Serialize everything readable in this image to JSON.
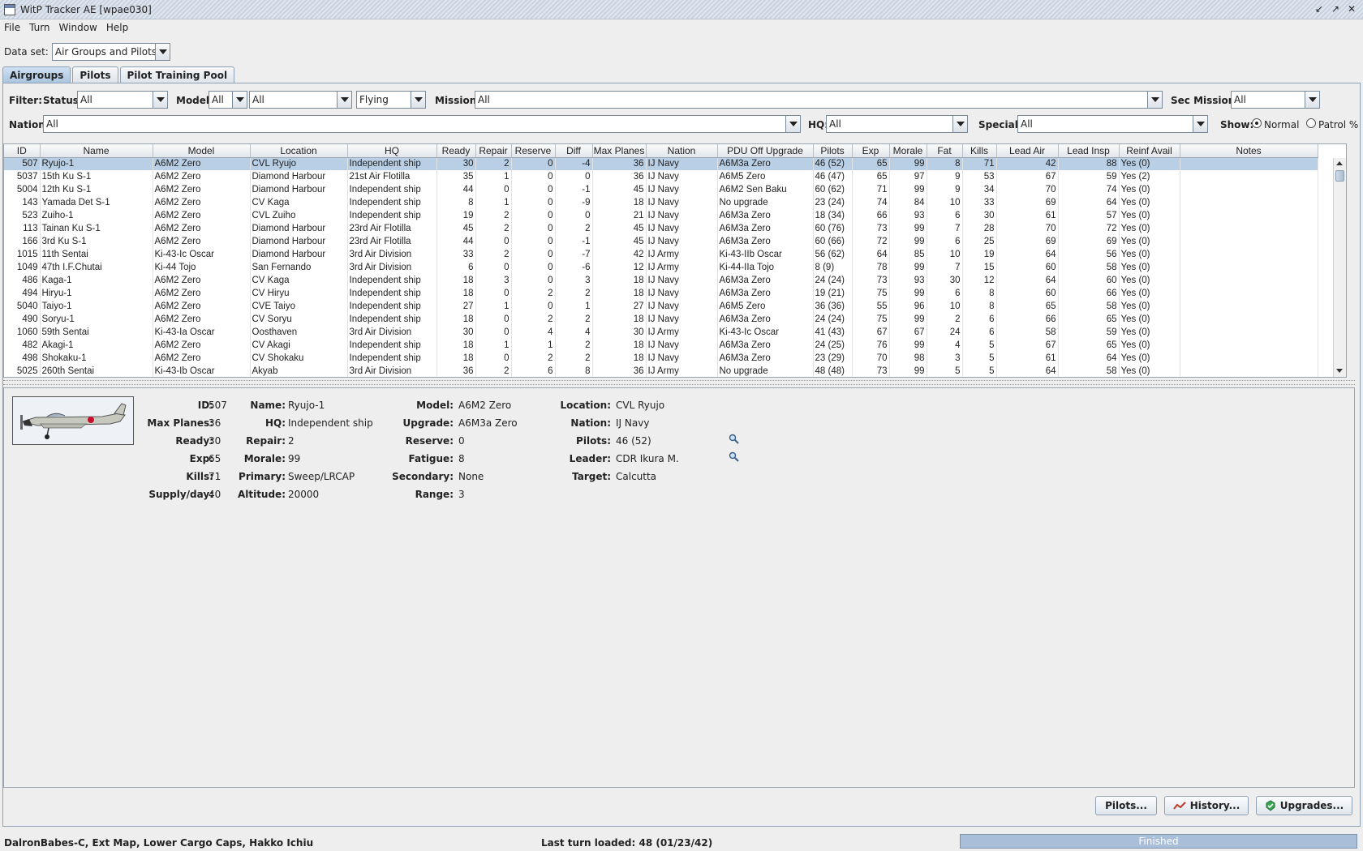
{
  "window": {
    "title": "WitP Tracker AE [wpae030]"
  },
  "menu": [
    "File",
    "Turn",
    "Window",
    "Help"
  ],
  "dataset": {
    "label": "Data set:",
    "value": "Air Groups and Pilots"
  },
  "tabs": [
    "Airgroups",
    "Pilots",
    "Pilot Training Pool"
  ],
  "filters": {
    "filter_label": "Filter:",
    "status_label": "Status:",
    "status_value": "All",
    "model_label": "Model:",
    "model_value1": "All",
    "model_value2": "All",
    "flying_value": "Flying",
    "mission_label": "Mission:",
    "mission_value": "All",
    "sec_mission_label": "Sec Mission:",
    "sec_mission_value": "All",
    "nation_label": "Nation:",
    "nation_value": "All",
    "hq_label": "HQ:",
    "hq_value": "All",
    "special_label": "Special:",
    "special_value": "All",
    "show_label": "Show:",
    "show_normal": "Normal",
    "show_patrol": "Patrol %"
  },
  "table": {
    "columns": [
      "ID",
      "Name",
      "Model",
      "Location",
      "HQ",
      "Ready",
      "Repair",
      "Reserve",
      "Diff",
      "Max Planes",
      "Nation",
      "PDU Off Upgrade",
      "Pilots",
      "Exp",
      "Morale",
      "Fat",
      "Kills",
      "Lead Air",
      "Lead Insp",
      "Reinf Avail",
      "Notes"
    ],
    "rows": [
      [
        "507",
        "Ryujo-1",
        "A6M2 Zero",
        "CVL Ryujo",
        "Independent ship",
        "30",
        "2",
        "0",
        "-4",
        "36",
        "IJ Navy",
        "A6M3a Zero",
        "46 (52)",
        "65",
        "99",
        "8",
        "71",
        "42",
        "88",
        "Yes (0)",
        ""
      ],
      [
        "5037",
        "15th Ku S-1",
        "A6M2 Zero",
        "Diamond Harbour",
        "21st Air Flotilla",
        "35",
        "1",
        "0",
        "0",
        "36",
        "IJ Navy",
        "A6M5 Zero",
        "46 (47)",
        "65",
        "97",
        "9",
        "53",
        "67",
        "59",
        "Yes (2)",
        ""
      ],
      [
        "5004",
        "12th Ku S-1",
        "A6M2 Zero",
        "Diamond Harbour",
        "Independent ship",
        "44",
        "0",
        "0",
        "-1",
        "45",
        "IJ Navy",
        "A6M2 Sen Baku",
        "60 (62)",
        "71",
        "99",
        "9",
        "34",
        "70",
        "74",
        "Yes (0)",
        ""
      ],
      [
        "143",
        "Yamada Det S-1",
        "A6M2 Zero",
        "CV Kaga",
        "Independent ship",
        "8",
        "1",
        "0",
        "-9",
        "18",
        "IJ Navy",
        "No upgrade",
        "23 (24)",
        "74",
        "84",
        "10",
        "33",
        "69",
        "64",
        "Yes (0)",
        ""
      ],
      [
        "523",
        "Zuiho-1",
        "A6M2 Zero",
        "CVL Zuiho",
        "Independent ship",
        "19",
        "2",
        "0",
        "0",
        "21",
        "IJ Navy",
        "A6M3a Zero",
        "18 (34)",
        "66",
        "93",
        "6",
        "30",
        "61",
        "57",
        "Yes (0)",
        ""
      ],
      [
        "113",
        "Tainan Ku S-1",
        "A6M2 Zero",
        "Diamond Harbour",
        "23rd Air Flotilla",
        "45",
        "2",
        "0",
        "2",
        "45",
        "IJ Navy",
        "A6M3a Zero",
        "60 (76)",
        "73",
        "99",
        "7",
        "28",
        "70",
        "72",
        "Yes (0)",
        ""
      ],
      [
        "166",
        "3rd Ku S-1",
        "A6M2 Zero",
        "Diamond Harbour",
        "23rd Air Flotilla",
        "44",
        "0",
        "0",
        "-1",
        "45",
        "IJ Navy",
        "A6M3a Zero",
        "60 (66)",
        "72",
        "99",
        "6",
        "25",
        "69",
        "69",
        "Yes (0)",
        ""
      ],
      [
        "1015",
        "11th Sentai",
        "Ki-43-Ic Oscar",
        "Diamond Harbour",
        "3rd Air Division",
        "33",
        "2",
        "0",
        "-7",
        "42",
        "IJ Army",
        "Ki-43-IIb Oscar",
        "56 (62)",
        "64",
        "85",
        "10",
        "19",
        "64",
        "56",
        "Yes (0)",
        ""
      ],
      [
        "1049",
        "47th I.F.Chutai",
        "Ki-44 Tojo",
        "San Fernando",
        "3rd Air Division",
        "6",
        "0",
        "0",
        "-6",
        "12",
        "IJ Army",
        "Ki-44-IIa Tojo",
        "8 (9)",
        "78",
        "99",
        "7",
        "15",
        "60",
        "58",
        "Yes (0)",
        ""
      ],
      [
        "486",
        "Kaga-1",
        "A6M2 Zero",
        "CV Kaga",
        "Independent ship",
        "18",
        "3",
        "0",
        "3",
        "18",
        "IJ Navy",
        "A6M3a Zero",
        "24 (24)",
        "73",
        "93",
        "30",
        "12",
        "64",
        "60",
        "Yes (0)",
        ""
      ],
      [
        "494",
        "Hiryu-1",
        "A6M2 Zero",
        "CV Hiryu",
        "Independent ship",
        "18",
        "0",
        "2",
        "2",
        "18",
        "IJ Navy",
        "A6M3a Zero",
        "19 (21)",
        "75",
        "99",
        "6",
        "8",
        "60",
        "66",
        "Yes (0)",
        ""
      ],
      [
        "5040",
        "Taiyo-1",
        "A6M2 Zero",
        "CVE Taiyo",
        "Independent ship",
        "27",
        "1",
        "0",
        "1",
        "27",
        "IJ Navy",
        "A6M5 Zero",
        "36 (36)",
        "55",
        "96",
        "10",
        "8",
        "65",
        "58",
        "Yes (0)",
        ""
      ],
      [
        "490",
        "Soryu-1",
        "A6M2 Zero",
        "CV Soryu",
        "Independent ship",
        "18",
        "0",
        "2",
        "2",
        "18",
        "IJ Navy",
        "A6M3a Zero",
        "24 (24)",
        "75",
        "99",
        "2",
        "6",
        "66",
        "65",
        "Yes (0)",
        ""
      ],
      [
        "1060",
        "59th Sentai",
        "Ki-43-Ia Oscar",
        "Oosthaven",
        "3rd Air Division",
        "30",
        "0",
        "4",
        "4",
        "30",
        "IJ Army",
        "Ki-43-Ic Oscar",
        "41 (43)",
        "67",
        "67",
        "24",
        "6",
        "58",
        "59",
        "Yes (0)",
        ""
      ],
      [
        "482",
        "Akagi-1",
        "A6M2 Zero",
        "CV Akagi",
        "Independent ship",
        "18",
        "1",
        "1",
        "2",
        "18",
        "IJ Navy",
        "A6M3a Zero",
        "24 (25)",
        "76",
        "99",
        "4",
        "5",
        "67",
        "65",
        "Yes (0)",
        ""
      ],
      [
        "498",
        "Shokaku-1",
        "A6M2 Zero",
        "CV Shokaku",
        "Independent ship",
        "18",
        "0",
        "2",
        "2",
        "18",
        "IJ Navy",
        "A6M3a Zero",
        "23 (29)",
        "70",
        "98",
        "3",
        "5",
        "61",
        "64",
        "Yes (0)",
        ""
      ],
      [
        "5025",
        "260th Sentai",
        "Ki-43-Ib Oscar",
        "Akyab",
        "3rd Air Division",
        "36",
        "2",
        "6",
        "8",
        "36",
        "IJ Army",
        "No upgrade",
        "48 (48)",
        "73",
        "99",
        "5",
        "5",
        "64",
        "58",
        "Yes (0)",
        ""
      ]
    ]
  },
  "detail": {
    "id_label": "ID:",
    "id": "507",
    "maxplanes_label": "Max Planes:",
    "maxplanes": "36",
    "ready_label": "Ready:",
    "ready": "30",
    "exp_label": "Exp:",
    "exp": "65",
    "kills_label": "Kills:",
    "kills": "71",
    "supply_label": "Supply/day:",
    "supply": "40",
    "name_label": "Name:",
    "name": "Ryujo-1",
    "hq_label": "HQ:",
    "hq": "Independent ship",
    "repair_label": "Repair:",
    "repair": "2",
    "morale_label": "Morale:",
    "morale": "99",
    "primary_label": "Primary:",
    "primary": "Sweep/LRCAP",
    "altitude_label": "Altitude:",
    "altitude": "20000",
    "model_label": "Model:",
    "model": "A6M2 Zero",
    "upgrade_label": "Upgrade:",
    "upgrade": "A6M3a Zero",
    "reserve_label": "Reserve:",
    "reserve": "0",
    "fatigue_label": "Fatigue:",
    "fatigue": "8",
    "secondary_label": "Secondary:",
    "secondary": "None",
    "range_label": "Range:",
    "range": "3",
    "location_label": "Location:",
    "location": "CVL Ryujo",
    "nation_label": "Nation:",
    "nation": "IJ Navy",
    "pilots_label": "Pilots:",
    "pilots": "46 (52)",
    "leader_label": "Leader:",
    "leader": "CDR Ikura M.",
    "target_label": "Target:",
    "target": "Calcutta"
  },
  "buttons": {
    "pilots": "Pilots...",
    "history": "History...",
    "upgrades": "Upgrades..."
  },
  "status": {
    "left": "DalronBabes-C, Ext Map, Lower Cargo Caps, Hakko Ichiu",
    "center": "Last turn loaded: 48 (01/23/42)",
    "progress": "Finished"
  }
}
